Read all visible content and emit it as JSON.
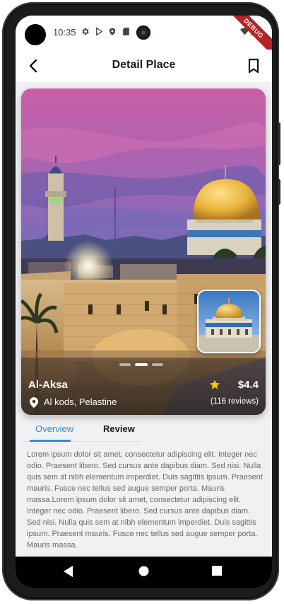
{
  "status_bar": {
    "time": "10:35",
    "icons": [
      "settings-icon",
      "play-store-icon",
      "shield-icon",
      "sd-card-icon",
      "wifi-icon",
      "signal-icon",
      "battery-icon"
    ],
    "debug_banner": "DEBUG"
  },
  "app_bar": {
    "title": "Detail Place",
    "back_icon": "back-arrow-icon",
    "bookmark_icon": "bookmark-icon"
  },
  "place": {
    "name": "Al-Aksa",
    "location": "Al kods, Pelastine",
    "price": "$4.4",
    "reviews": "(116 reviews)",
    "carousel_page_count": 3,
    "carousel_active_index": 1
  },
  "tabs": [
    {
      "label": "Overview",
      "active": true
    },
    {
      "label": "Review",
      "active": false
    }
  ],
  "description": "Lorem ipsum dolor sit amet, consectetur adipiscing elit. Integer nec odio. Praesent libero. Sed cursus ante dapibus diam. Sed nisi. Nulla quis sem at nibh elementum imperdiet. Duis sagittis ipsum. Praesent mauris. Fusce nec tellus sed augue semper porta. Mauris massa.Lorem ipsum dolor sit amet, consectetur adipiscing elit. Integer nec odio. Praesent libero. Sed cursus ante dapibus diam. Sed nisi. Nulla quis sem at nibh elementum imperdiet. Duis sagittis ipsum. Praesent mauris. Fusce nec tellus sed augue semper porta. Mauris massa.",
  "colors": {
    "accent": "#2d8ed6",
    "star": "#f5c518",
    "dome": "#e8b43a"
  },
  "nav_bar": [
    "back-triangle-icon",
    "home-circle-icon",
    "recents-square-icon"
  ]
}
